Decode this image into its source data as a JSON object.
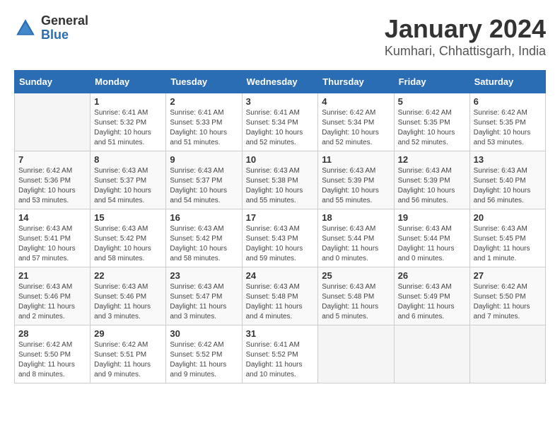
{
  "header": {
    "logo_general": "General",
    "logo_blue": "Blue",
    "month_title": "January 2024",
    "location": "Kumhari, Chhattisgarh, India"
  },
  "days_of_week": [
    "Sunday",
    "Monday",
    "Tuesday",
    "Wednesday",
    "Thursday",
    "Friday",
    "Saturday"
  ],
  "weeks": [
    [
      {
        "day": "",
        "info": ""
      },
      {
        "day": "1",
        "info": "Sunrise: 6:41 AM\nSunset: 5:32 PM\nDaylight: 10 hours\nand 51 minutes."
      },
      {
        "day": "2",
        "info": "Sunrise: 6:41 AM\nSunset: 5:33 PM\nDaylight: 10 hours\nand 51 minutes."
      },
      {
        "day": "3",
        "info": "Sunrise: 6:41 AM\nSunset: 5:34 PM\nDaylight: 10 hours\nand 52 minutes."
      },
      {
        "day": "4",
        "info": "Sunrise: 6:42 AM\nSunset: 5:34 PM\nDaylight: 10 hours\nand 52 minutes."
      },
      {
        "day": "5",
        "info": "Sunrise: 6:42 AM\nSunset: 5:35 PM\nDaylight: 10 hours\nand 52 minutes."
      },
      {
        "day": "6",
        "info": "Sunrise: 6:42 AM\nSunset: 5:35 PM\nDaylight: 10 hours\nand 53 minutes."
      }
    ],
    [
      {
        "day": "7",
        "info": "Sunrise: 6:42 AM\nSunset: 5:36 PM\nDaylight: 10 hours\nand 53 minutes."
      },
      {
        "day": "8",
        "info": "Sunrise: 6:43 AM\nSunset: 5:37 PM\nDaylight: 10 hours\nand 54 minutes."
      },
      {
        "day": "9",
        "info": "Sunrise: 6:43 AM\nSunset: 5:37 PM\nDaylight: 10 hours\nand 54 minutes."
      },
      {
        "day": "10",
        "info": "Sunrise: 6:43 AM\nSunset: 5:38 PM\nDaylight: 10 hours\nand 55 minutes."
      },
      {
        "day": "11",
        "info": "Sunrise: 6:43 AM\nSunset: 5:39 PM\nDaylight: 10 hours\nand 55 minutes."
      },
      {
        "day": "12",
        "info": "Sunrise: 6:43 AM\nSunset: 5:39 PM\nDaylight: 10 hours\nand 56 minutes."
      },
      {
        "day": "13",
        "info": "Sunrise: 6:43 AM\nSunset: 5:40 PM\nDaylight: 10 hours\nand 56 minutes."
      }
    ],
    [
      {
        "day": "14",
        "info": "Sunrise: 6:43 AM\nSunset: 5:41 PM\nDaylight: 10 hours\nand 57 minutes."
      },
      {
        "day": "15",
        "info": "Sunrise: 6:43 AM\nSunset: 5:42 PM\nDaylight: 10 hours\nand 58 minutes."
      },
      {
        "day": "16",
        "info": "Sunrise: 6:43 AM\nSunset: 5:42 PM\nDaylight: 10 hours\nand 58 minutes."
      },
      {
        "day": "17",
        "info": "Sunrise: 6:43 AM\nSunset: 5:43 PM\nDaylight: 10 hours\nand 59 minutes."
      },
      {
        "day": "18",
        "info": "Sunrise: 6:43 AM\nSunset: 5:44 PM\nDaylight: 11 hours\nand 0 minutes."
      },
      {
        "day": "19",
        "info": "Sunrise: 6:43 AM\nSunset: 5:44 PM\nDaylight: 11 hours\nand 0 minutes."
      },
      {
        "day": "20",
        "info": "Sunrise: 6:43 AM\nSunset: 5:45 PM\nDaylight: 11 hours\nand 1 minute."
      }
    ],
    [
      {
        "day": "21",
        "info": "Sunrise: 6:43 AM\nSunset: 5:46 PM\nDaylight: 11 hours\nand 2 minutes."
      },
      {
        "day": "22",
        "info": "Sunrise: 6:43 AM\nSunset: 5:46 PM\nDaylight: 11 hours\nand 3 minutes."
      },
      {
        "day": "23",
        "info": "Sunrise: 6:43 AM\nSunset: 5:47 PM\nDaylight: 11 hours\nand 3 minutes."
      },
      {
        "day": "24",
        "info": "Sunrise: 6:43 AM\nSunset: 5:48 PM\nDaylight: 11 hours\nand 4 minutes."
      },
      {
        "day": "25",
        "info": "Sunrise: 6:43 AM\nSunset: 5:48 PM\nDaylight: 11 hours\nand 5 minutes."
      },
      {
        "day": "26",
        "info": "Sunrise: 6:43 AM\nSunset: 5:49 PM\nDaylight: 11 hours\nand 6 minutes."
      },
      {
        "day": "27",
        "info": "Sunrise: 6:42 AM\nSunset: 5:50 PM\nDaylight: 11 hours\nand 7 minutes."
      }
    ],
    [
      {
        "day": "28",
        "info": "Sunrise: 6:42 AM\nSunset: 5:50 PM\nDaylight: 11 hours\nand 8 minutes."
      },
      {
        "day": "29",
        "info": "Sunrise: 6:42 AM\nSunset: 5:51 PM\nDaylight: 11 hours\nand 9 minutes."
      },
      {
        "day": "30",
        "info": "Sunrise: 6:42 AM\nSunset: 5:52 PM\nDaylight: 11 hours\nand 9 minutes."
      },
      {
        "day": "31",
        "info": "Sunrise: 6:41 AM\nSunset: 5:52 PM\nDaylight: 11 hours\nand 10 minutes."
      },
      {
        "day": "",
        "info": ""
      },
      {
        "day": "",
        "info": ""
      },
      {
        "day": "",
        "info": ""
      }
    ]
  ]
}
